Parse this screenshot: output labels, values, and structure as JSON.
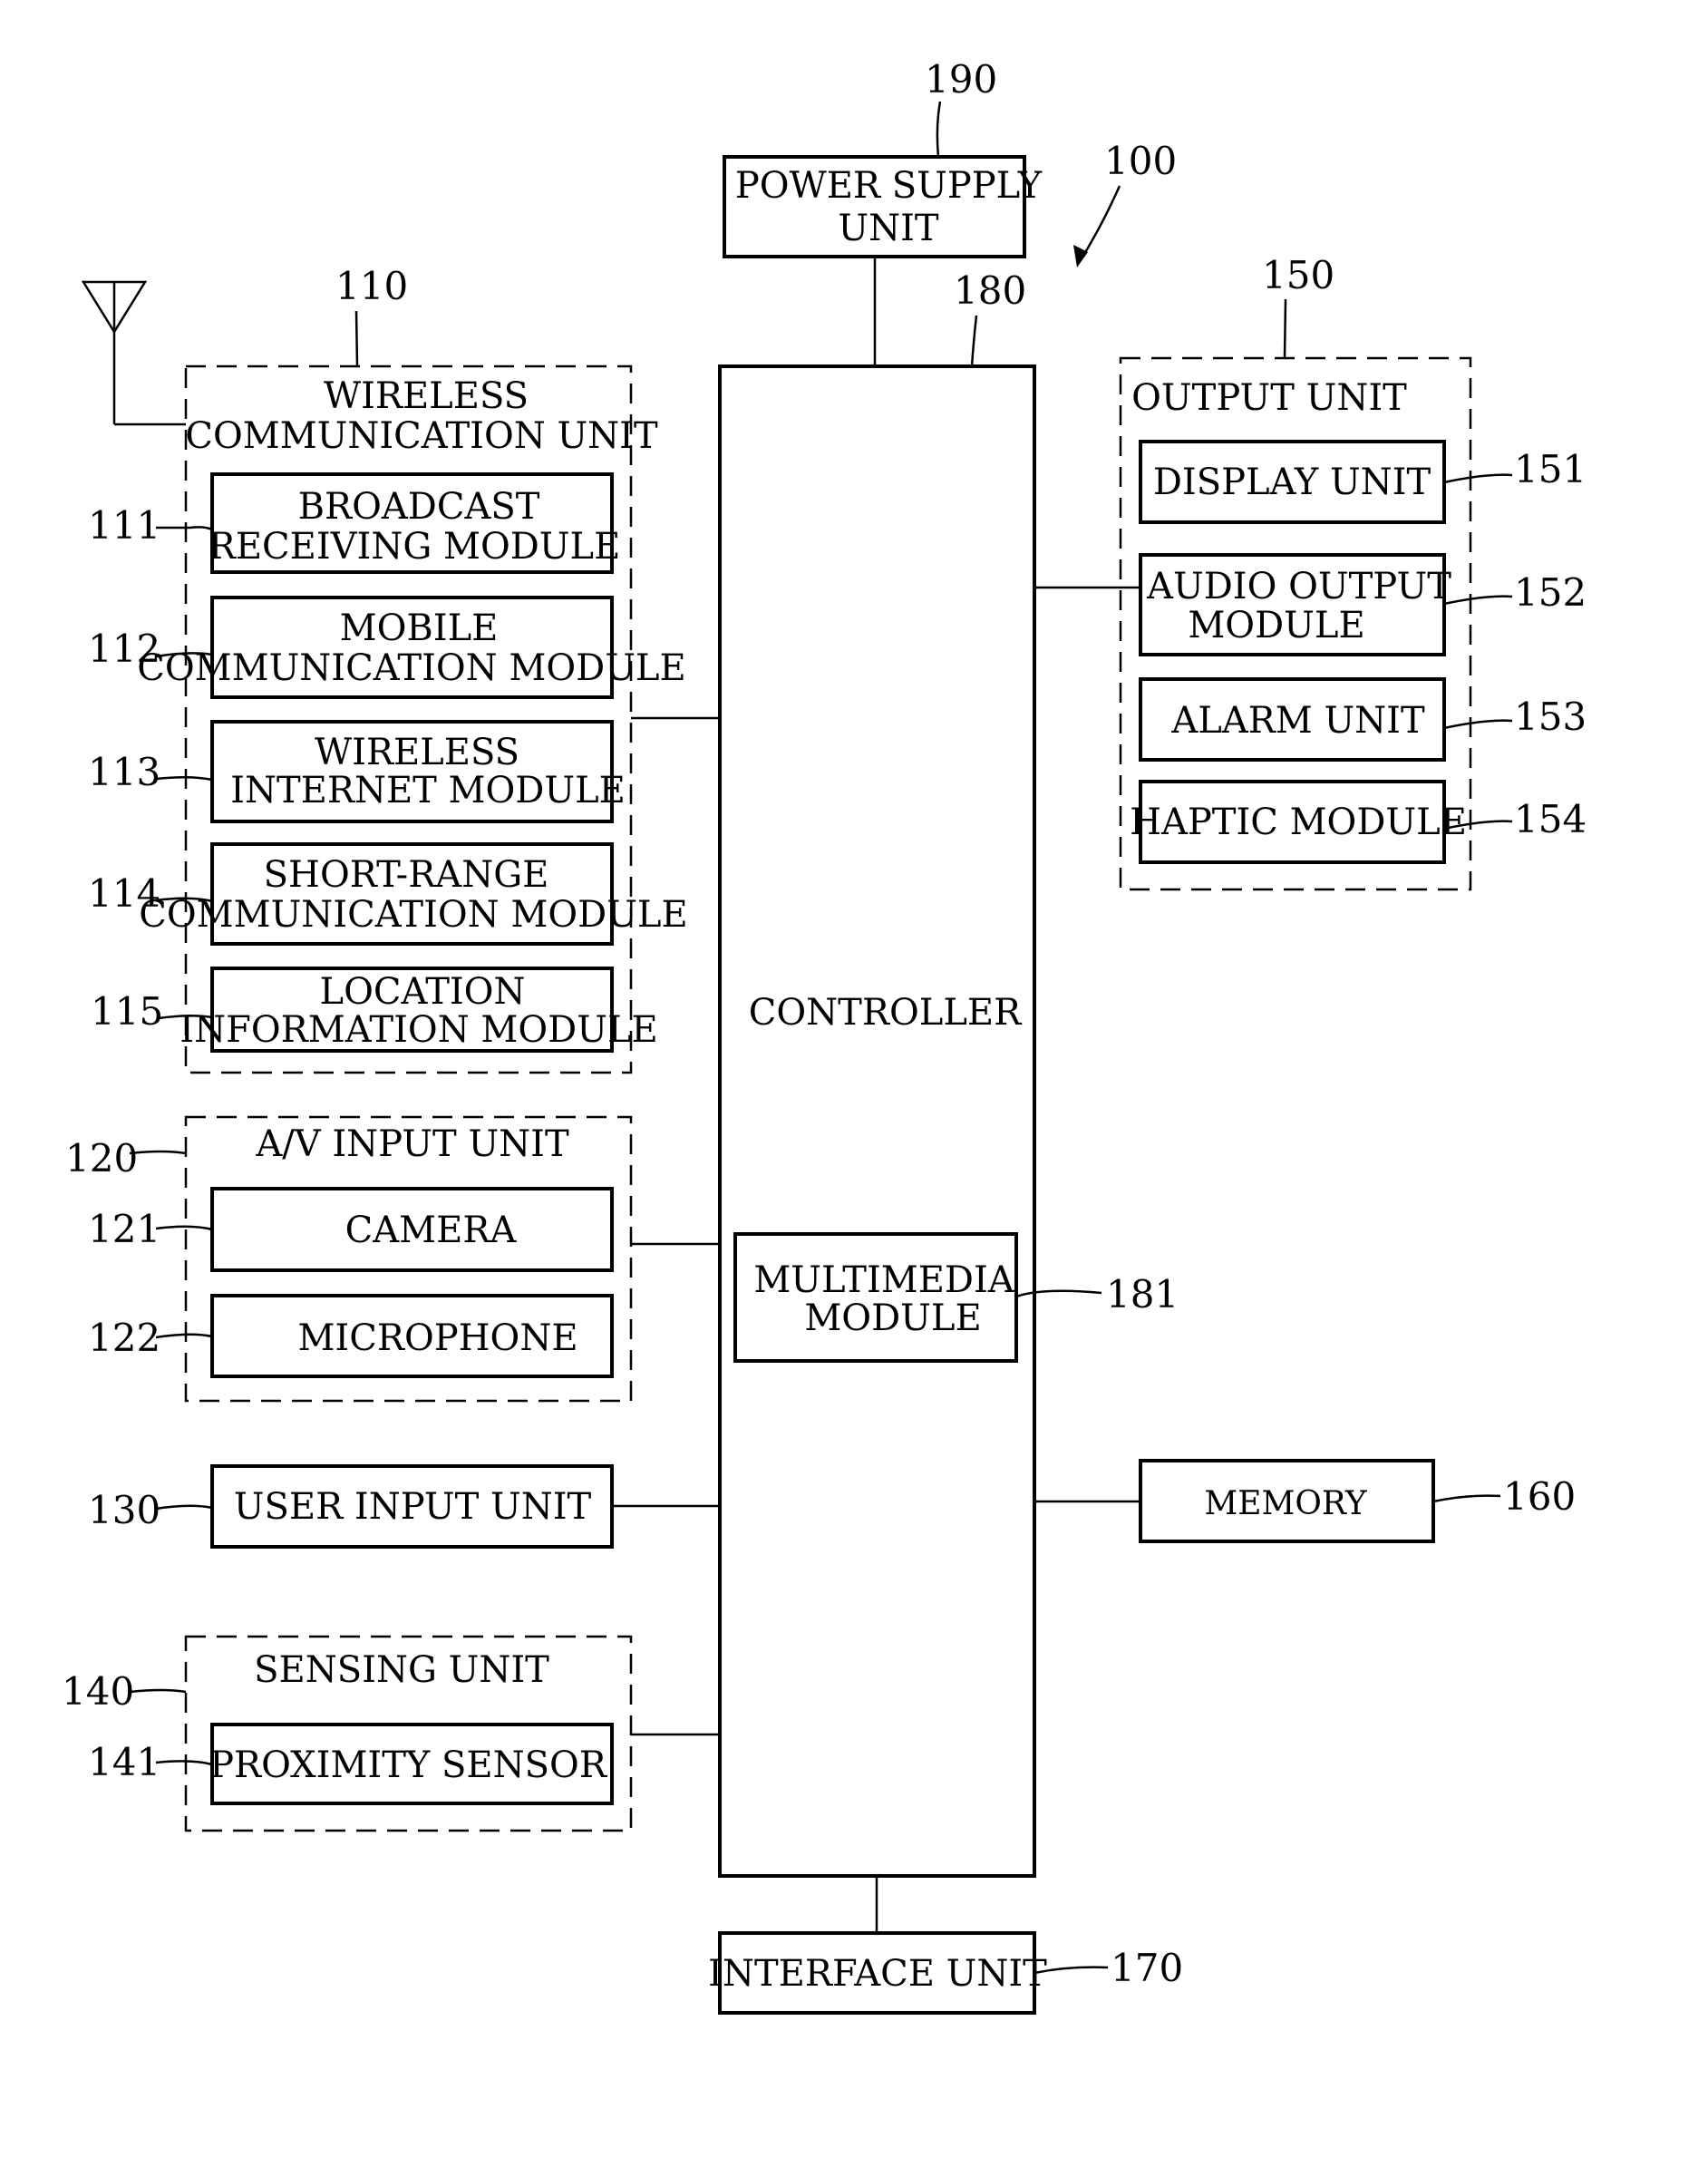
{
  "figure": {
    "device_ref": "100",
    "power_supply": {
      "ref": "190",
      "lines": [
        "POWER SUPPLY",
        "UNIT"
      ]
    },
    "controller": {
      "ref": "180",
      "label": "CONTROLLER"
    },
    "multimedia": {
      "ref": "181",
      "lines": [
        "MULTIMEDIA",
        "MODULE"
      ]
    },
    "interface": {
      "ref": "170",
      "label": "INTERFACE UNIT"
    },
    "memory": {
      "ref": "160",
      "label": "MEMORY"
    },
    "wireless": {
      "ref": "110",
      "lines": [
        "WIRELESS",
        "COMMUNICATION UNIT"
      ],
      "modules": [
        {
          "ref": "111",
          "lines": [
            "BROADCAST",
            "RECEIVING MODULE"
          ]
        },
        {
          "ref": "112",
          "lines": [
            "MOBILE",
            "COMMUNICATION MODULE"
          ]
        },
        {
          "ref": "113",
          "lines": [
            "WIRELESS",
            "INTERNET MODULE"
          ]
        },
        {
          "ref": "114",
          "lines": [
            "SHORT-RANGE",
            "COMMUNICATION MODULE"
          ]
        },
        {
          "ref": "115",
          "lines": [
            "LOCATION",
            "INFORMATION MODULE"
          ]
        }
      ]
    },
    "av_input": {
      "ref": "120",
      "label": "A/V INPUT UNIT",
      "modules": [
        {
          "ref": "121",
          "label": "CAMERA"
        },
        {
          "ref": "122",
          "label": "MICROPHONE"
        }
      ]
    },
    "user_input": {
      "ref": "130",
      "label": "USER INPUT UNIT"
    },
    "sensing": {
      "ref": "140",
      "label": "SENSING UNIT",
      "modules": [
        {
          "ref": "141",
          "label": "PROXIMITY SENSOR"
        }
      ]
    },
    "output": {
      "ref": "150",
      "label": "OUTPUT UNIT",
      "modules": [
        {
          "ref": "151",
          "lines": [
            "DISPLAY UNIT"
          ]
        },
        {
          "ref": "152",
          "lines": [
            "AUDIO OUTPUT",
            "MODULE"
          ]
        },
        {
          "ref": "153",
          "lines": [
            "ALARM UNIT"
          ]
        },
        {
          "ref": "154",
          "lines": [
            "HAPTIC MODULE"
          ]
        }
      ]
    }
  }
}
